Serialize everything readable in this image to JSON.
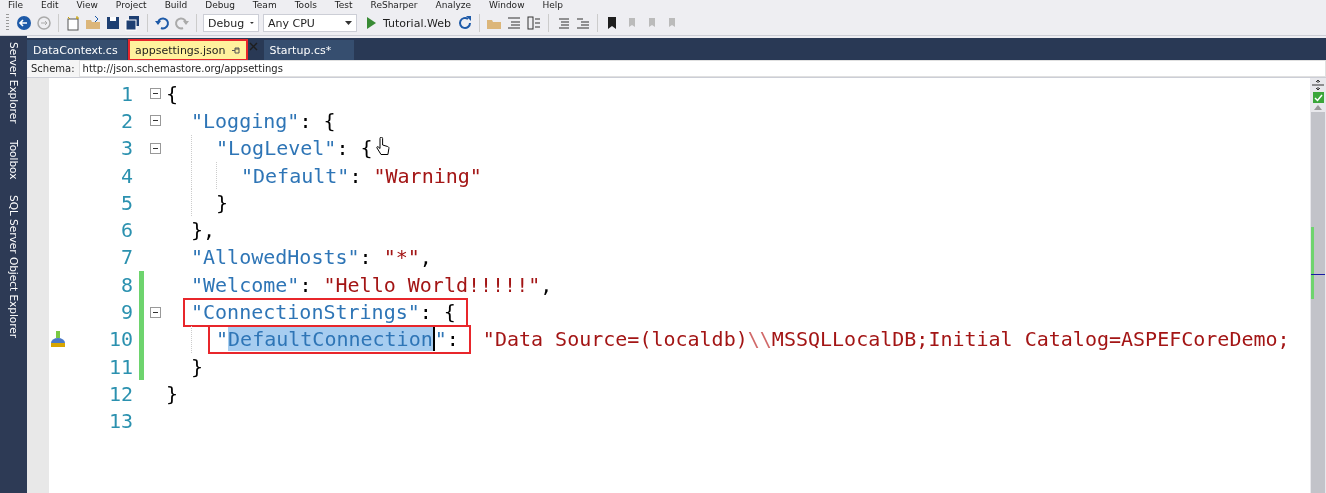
{
  "menu": [
    "File",
    "Edit",
    "View",
    "Project",
    "Build",
    "Debug",
    "Team",
    "Tools",
    "Test",
    "ReSharper",
    "Analyze",
    "Window",
    "Help"
  ],
  "toolbar": {
    "configuration": "Debug",
    "platform": "Any CPU",
    "start_target": "Tutorial.Web"
  },
  "tabs": [
    {
      "label": "DataContext.cs",
      "selected": false,
      "annotated": false
    },
    {
      "label": "appsettings.json",
      "selected": true,
      "annotated": true
    },
    {
      "label": "Startup.cs*",
      "selected": false,
      "annotated": false
    }
  ],
  "side_panels": [
    "Server Explorer",
    "Toolbox",
    "SQL Server Object Explorer"
  ],
  "schema": {
    "label": "Schema:",
    "url": "http://json.schemastore.org/appsettings"
  },
  "editor": {
    "lines": [
      {
        "number": "1",
        "foldable": true,
        "changed": false,
        "pointer": false,
        "quick_action": false,
        "tokens": [
          {
            "kind": "punct",
            "text": "{"
          }
        ],
        "children": [
          {
            "number": "2",
            "foldable": true,
            "changed": false,
            "pointer": false,
            "quick_action": false,
            "tokens": [
              {
                "kind": "key",
                "text": "\"Logging\""
              },
              {
                "kind": "punct",
                "text": ": {"
              }
            ],
            "children": [
              {
                "number": "3",
                "foldable": true,
                "changed": false,
                "pointer": true,
                "quick_action": false,
                "tokens": [
                  {
                    "kind": "key",
                    "text": "\"LogLevel\""
                  },
                  {
                    "kind": "punct",
                    "text": ": {"
                  }
                ],
                "children": [
                  {
                    "number": "4",
                    "foldable": false,
                    "changed": false,
                    "pointer": false,
                    "quick_action": false,
                    "tokens": [
                      {
                        "kind": "key",
                        "text": "\"Default\""
                      },
                      {
                        "kind": "punct",
                        "text": ": "
                      },
                      {
                        "kind": "string",
                        "text": "\"Warning\""
                      }
                    ]
                  }
                ]
              },
              {
                "number": "5",
                "foldable": false,
                "changed": false,
                "pointer": false,
                "quick_action": false,
                "tokens": [
                  {
                    "kind": "punct",
                    "text": "}"
                  }
                ]
              }
            ]
          },
          {
            "number": "6",
            "foldable": false,
            "changed": false,
            "pointer": false,
            "quick_action": false,
            "tokens": [
              {
                "kind": "punct",
                "text": "},"
              }
            ]
          },
          {
            "number": "7",
            "foldable": false,
            "changed": false,
            "pointer": false,
            "quick_action": false,
            "tokens": [
              {
                "kind": "key",
                "text": "\"AllowedHosts\""
              },
              {
                "kind": "punct",
                "text": ": "
              },
              {
                "kind": "string",
                "text": "\"*\""
              },
              {
                "kind": "punct",
                "text": ","
              }
            ]
          },
          {
            "number": "8",
            "foldable": false,
            "changed": true,
            "pointer": false,
            "quick_action": false,
            "tokens": [
              {
                "kind": "key",
                "text": "\"Welcome\""
              },
              {
                "kind": "punct",
                "text": ": "
              },
              {
                "kind": "string",
                "text": "\"Hello World!!!!!\""
              },
              {
                "kind": "punct",
                "text": ","
              }
            ]
          },
          {
            "number": "9",
            "foldable": true,
            "changed": true,
            "pointer": false,
            "quick_action": false,
            "tokens": [
              {
                "kind": "box",
                "tokens": [
                  {
                    "kind": "key",
                    "text": "\"ConnectionStrings\""
                  },
                  {
                    "kind": "punct",
                    "text": ": {"
                  }
                ]
              }
            ],
            "children": [
              {
                "number": "10",
                "foldable": false,
                "changed": true,
                "pointer": false,
                "quick_action": true,
                "tokens": [
                  {
                    "kind": "box",
                    "tokens": [
                      {
                        "kind": "key",
                        "text": "\""
                      },
                      {
                        "kind": "key",
                        "text": "DefaultConnection",
                        "selected": true
                      },
                      {
                        "kind": "key",
                        "text": "\""
                      },
                      {
                        "kind": "punct",
                        "text": ":"
                      }
                    ]
                  },
                  {
                    "kind": "string",
                    "text": "\"Data Source=(localdb)"
                  },
                  {
                    "kind": "escape",
                    "text": "\\\\"
                  },
                  {
                    "kind": "string",
                    "text": "MSSQLLocalDB;Initial Catalog=ASPEFCoreDemo;"
                  }
                ]
              }
            ]
          },
          {
            "number": "11",
            "foldable": false,
            "changed": true,
            "pointer": false,
            "quick_action": false,
            "tokens": [
              {
                "kind": "punct",
                "text": "}"
              }
            ]
          }
        ]
      },
      {
        "number": "12",
        "foldable": false,
        "changed": false,
        "pointer": false,
        "quick_action": false,
        "tokens": [
          {
            "kind": "punct",
            "text": "}"
          }
        ]
      },
      {
        "number": "13",
        "foldable": false,
        "changed": false,
        "pointer": false,
        "quick_action": false
      }
    ]
  }
}
